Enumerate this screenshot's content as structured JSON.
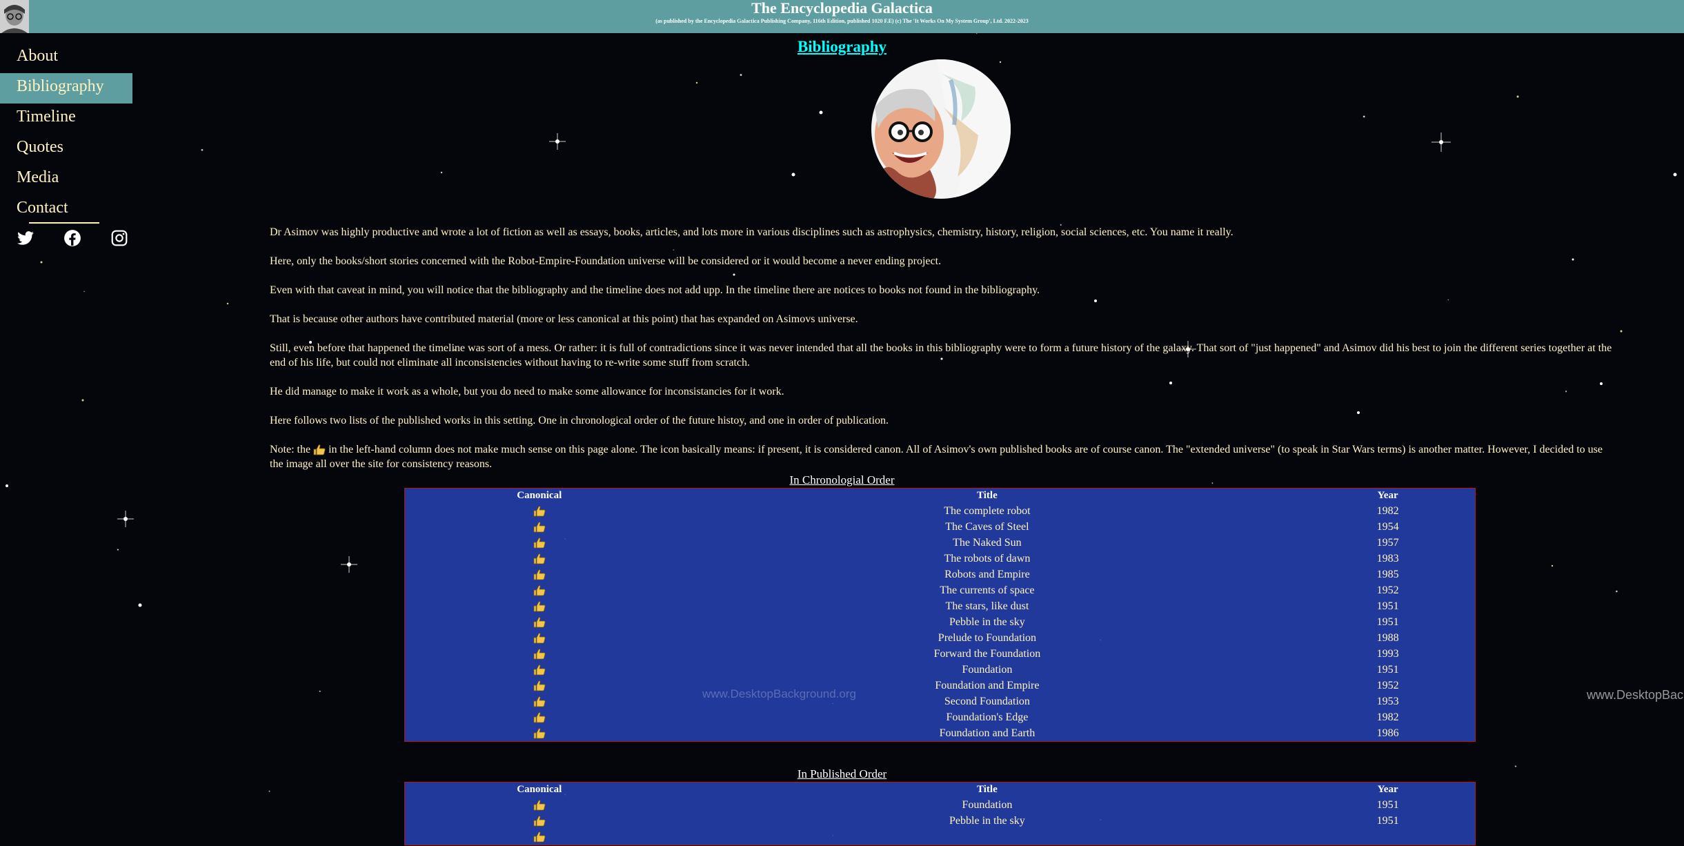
{
  "header": {
    "title": "The Encyclopedia Galactica",
    "subtitle": "(as published by the Encyclopedia Galactica Publishing Company, 116th Edition, published 1020 F.E) (c) The 'It Works On My System Group', Ltd. 2022-2023"
  },
  "nav": {
    "items": [
      {
        "label": "About"
      },
      {
        "label": "Bibliography"
      },
      {
        "label": "Timeline"
      },
      {
        "label": "Quotes"
      },
      {
        "label": "Media"
      },
      {
        "label": "Contact"
      }
    ],
    "active": "Bibliography",
    "social_icons": [
      "twitter-icon",
      "facebook-icon",
      "instagram-icon"
    ]
  },
  "main": {
    "title": "Bibliography",
    "intro": [
      "Dr Asimov was highly productive and wrote a lot of fiction as well as essays, books, articles, and lots more in various disciplines such as astrophysics, chemistry, history, religion, social sciences, etc. You name it really.",
      "Here, only the books/short stories concerned with the Robot-Empire-Foundation universe will be considered or it would become a never ending project.",
      "Even with that caveat in mind, you will notice that the bibliography and the timeline does not add upp. In the timeline there are notices to books not found in the bibliography.",
      "That is because other authors have contributed material (more or less canonical at this point) that has expanded on Asimovs universe.",
      "Still, even before that happened the timeline was sort of a mess. Or rather: it is full of contradictions since it was never intended that all the books in this bibliography were to form a future history of the galaxy. That sort of \"just happened\" and Asimov did his best to join the different series together at the end of his life, but could not eliminate all inconsistencies without having to re-write some stuff from scratch.",
      "He did manage to make it work as a whole, but you do need to make some allowance for inconsistancies for it work.",
      "Here follows two lists of the published works in this setting. One in chronological order of the future histoy, and one in order of publication."
    ],
    "note_before": "Note: the ",
    "note_after": " in the left-hand column does not make much sense on this page alone. The icon basically means: if present, it is considered canon. All of Asimov's own published books are of course canon. The \"extended universe\" (to speak in Star Wars terms) is another matter. However, I decided to use the image all over the site for consistency reasons."
  },
  "table_headers": {
    "canonical": "Canonical",
    "title": "Title",
    "year": "Year"
  },
  "chronological": {
    "caption": "In Chronologial Order",
    "rows": [
      {
        "title": "The complete robot",
        "year": "1982",
        "canon": true
      },
      {
        "title": "The Caves of Steel",
        "year": "1954",
        "canon": true
      },
      {
        "title": "The Naked Sun",
        "year": "1957",
        "canon": true
      },
      {
        "title": "The robots of dawn",
        "year": "1983",
        "canon": true
      },
      {
        "title": "Robots and Empire",
        "year": "1985",
        "canon": true
      },
      {
        "title": "The currents of space",
        "year": "1952",
        "canon": true
      },
      {
        "title": "The stars, like dust",
        "year": "1951",
        "canon": true
      },
      {
        "title": "Pebble in the sky",
        "year": "1951",
        "canon": true
      },
      {
        "title": "Prelude to Foundation",
        "year": "1988",
        "canon": true
      },
      {
        "title": "Forward the Foundation",
        "year": "1993",
        "canon": true
      },
      {
        "title": "Foundation",
        "year": "1951",
        "canon": true
      },
      {
        "title": "Foundation and Empire",
        "year": "1952",
        "canon": true
      },
      {
        "title": "Second Foundation",
        "year": "1953",
        "canon": true
      },
      {
        "title": "Foundation's Edge",
        "year": "1982",
        "canon": true
      },
      {
        "title": "Foundation and Earth",
        "year": "1986",
        "canon": true
      }
    ]
  },
  "published": {
    "caption": "In Published Order",
    "rows": [
      {
        "title": "Foundation",
        "year": "1951",
        "canon": true
      },
      {
        "title": "Pebble in the sky",
        "year": "1951",
        "canon": true
      },
      {
        "title": "",
        "year": "",
        "canon": true
      }
    ]
  },
  "watermark": "www.DesktopBackground.org",
  "watermark_cut": "www.DesktopBac",
  "colors": {
    "header_bg": "#5f9ea0",
    "nav_text": "#fff3c2",
    "title_link": "#00ffff",
    "table_bg": "#21399a",
    "table_border": "#b8121a"
  }
}
